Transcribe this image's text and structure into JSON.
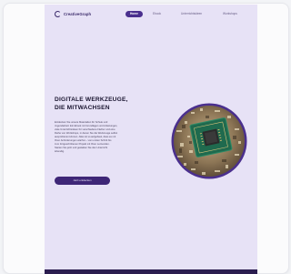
{
  "header": {
    "logo_text": "CreativeGraph",
    "nav": [
      "Home",
      "Ebook",
      "Unterrichtsideen",
      "Workshops"
    ]
  },
  "hero": {
    "headline_lines": [
      "DIGITALE WERKZEUGE,",
      "DIE MITWACHSEN"
    ],
    "body_lines": [
      "Entdecken Sie unsere Materialien für Schule und",
      "Jugendarbeit: Ein Ebook mit Grundlagen und Anleitungen,",
      "viele Unterrichtsideen für verschiedene Fächer und eine",
      "Reihe von Workshops, in denen Sie die Werkzeuge selbst",
      "ausprobieren können. Alles ist so aufgebaut, dass es mit",
      "Ihren Anforderungen wächst – vom ersten Schritt bis",
      "zum fortgeschrittenen Projekt mit Ihren Lernenden.",
      "Starten Sie jetzt und gestalten Sie den Unterricht",
      "lebendig."
    ],
    "cta_label": "Jetzt entdecken"
  },
  "colors": {
    "accent": "#4a2f8e",
    "page_bg": "#e7e2f6",
    "footer": "#2b1d4f"
  },
  "icons": {
    "logo": "logo-icon",
    "hero_image": "circuit-chip-image"
  }
}
